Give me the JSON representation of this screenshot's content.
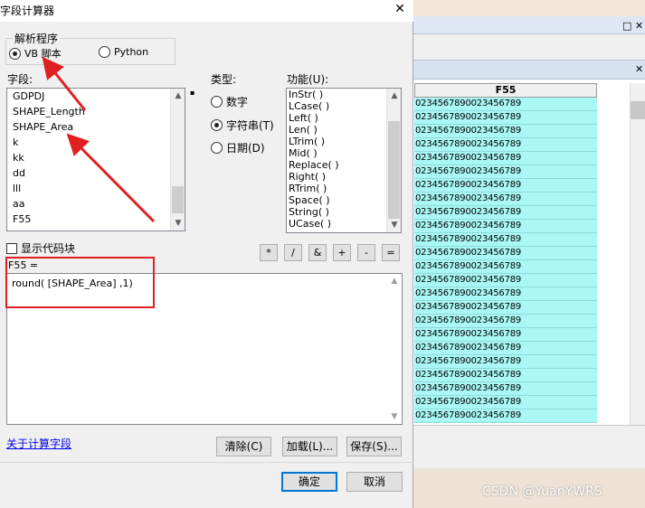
{
  "dialog": {
    "title": "字段计算器",
    "close_label": "✕",
    "parser_group_label": "解析程序",
    "parser_options": [
      {
        "label": "VB 脚本",
        "selected": true
      },
      {
        "label": "Python",
        "selected": false
      }
    ],
    "fields_label": "字段:",
    "fields": [
      "GDPDJ",
      "SHAPE_Length",
      "SHAPE_Area",
      "k",
      "kk",
      "dd",
      "lll",
      "aa",
      "F55"
    ],
    "type_label": "类型:",
    "type_options": [
      {
        "label": "数字",
        "selected": false
      },
      {
        "label": "字符串(T)",
        "selected": true
      },
      {
        "label": "日期(D)",
        "selected": false
      }
    ],
    "functions_label": "功能(U):",
    "functions": [
      "InStr( )",
      "LCase( )",
      "Left( )",
      "Len( )",
      "LTrim( )",
      "Mid( )",
      "Replace( )",
      "Right( )",
      "RTrim( )",
      "Space( )",
      "String( )",
      "UCase( )"
    ],
    "show_codeblock_label": "显示代码块",
    "operators": [
      "*",
      "/",
      "&",
      "+",
      "-",
      "="
    ],
    "expression_label": "F55 =",
    "expression": "round( [SHAPE_Area] ,1)",
    "help_link": "关于计算字段",
    "clear_button": "清除(C)",
    "load_button": "加载(L)...",
    "save_button": "保存(S)...",
    "ok_button": "确定",
    "cancel_button": "取消"
  },
  "table": {
    "column_header": "F55",
    "rows": [
      "0234567890023456789",
      "0234567890023456789",
      "0234567890023456789",
      "0234567890023456789",
      "0234567890023456789",
      "0234567890023456789",
      "0234567890023456789",
      "0234567890023456789",
      "0234567890023456789",
      "0234567890023456789",
      "0234567890023456789",
      "0234567890023456789",
      "0234567890023456789",
      "0234567890023456789",
      "0234567890023456789",
      "0234567890023456789",
      "0234567890023456789",
      "0234567890023456789",
      "0234567890023456789",
      "0234567890023456789",
      "0234567890023456789",
      "0234567890023456789",
      "0234567890023456789",
      "0234567890023456789"
    ]
  },
  "background_window": {
    "restore_label": "□",
    "close_label": "✕"
  },
  "watermark": "CSDN @YuanYWRS",
  "colors": {
    "annotation_red": "#e02020",
    "selected_cell": "#a9f8f6",
    "link_blue": "#0000ee"
  }
}
